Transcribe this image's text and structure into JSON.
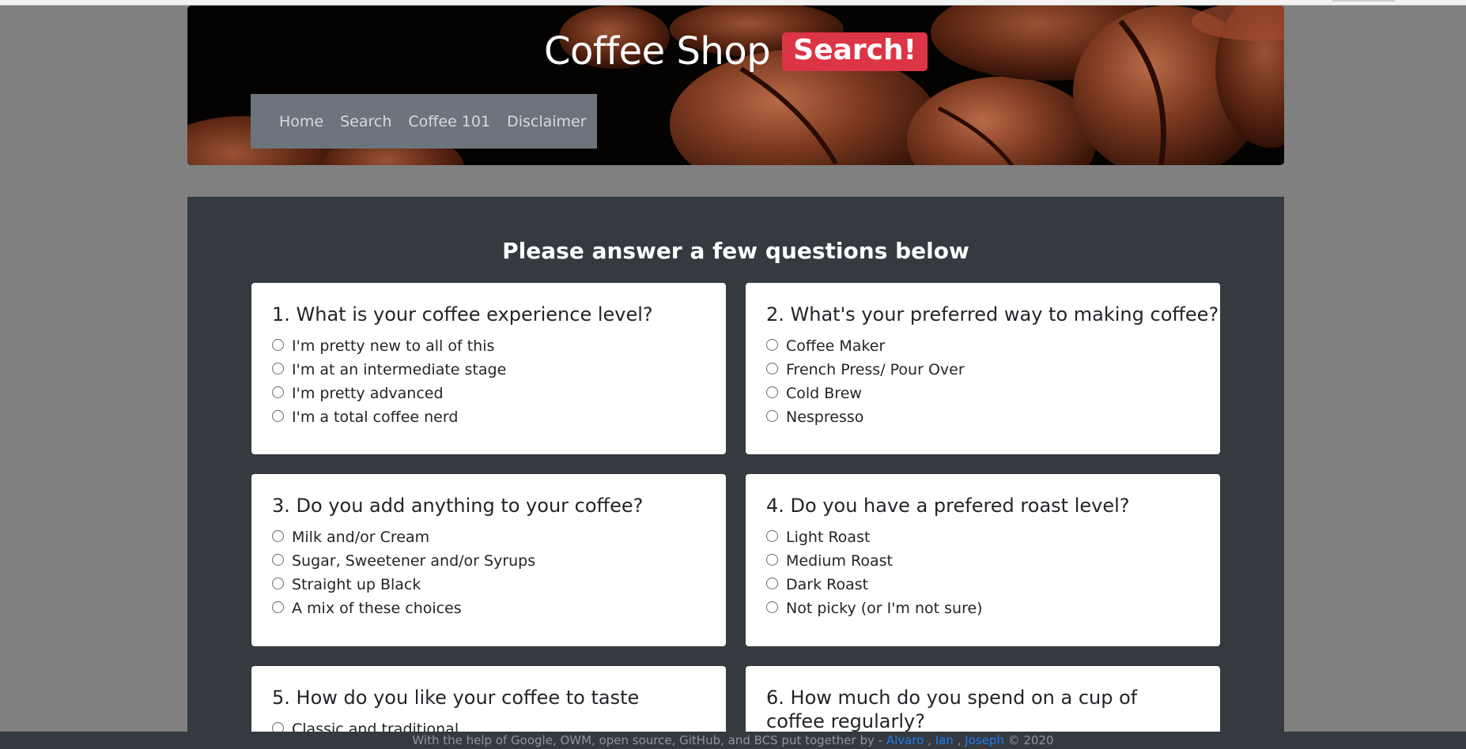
{
  "header": {
    "site_name": "Coffee Shop",
    "badge": "Search!",
    "nav": [
      "Home",
      "Search",
      "Coffee 101",
      "Disclaimer"
    ]
  },
  "main": {
    "title": "Please answer a few questions below",
    "questions": [
      {
        "title": "1. What is your coffee experience level?",
        "options": [
          "I'm pretty new to all of this",
          "I'm at an intermediate stage",
          "I'm pretty advanced",
          "I'm a total coffee nerd"
        ]
      },
      {
        "title": "2. What's your preferred way to making coffee?",
        "options": [
          "Coffee Maker",
          "French Press/ Pour Over",
          "Cold Brew",
          "Nespresso"
        ]
      },
      {
        "title": "3. Do you add anything to your coffee?",
        "options": [
          "Milk and/or Cream",
          "Sugar, Sweetener and/or Syrups",
          "Straight up Black",
          "A mix of these choices"
        ]
      },
      {
        "title": "4. Do you have a prefered roast level?",
        "options": [
          "Light Roast",
          "Medium Roast",
          "Dark Roast",
          "Not picky (or I'm not sure)"
        ]
      },
      {
        "title": "5. How do you like your coffee to taste",
        "options": [
          "Classic and traditional"
        ]
      },
      {
        "title": "6. How much do you spend on a cup of coffee regularly?",
        "options": []
      }
    ]
  },
  "footer": {
    "text": "With the help of Google, OWM, open source, GitHub, and BCS put together by -",
    "authors": [
      "Alvaro",
      "Ian",
      "Joseph"
    ],
    "separator": ",",
    "copyright": "© 2020"
  },
  "colors": {
    "page_bg": "#808080",
    "panel_bg": "#343a40",
    "nav_bg": "#6c757d",
    "badge_bg": "#dc3545",
    "link": "#1e7cf5"
  }
}
